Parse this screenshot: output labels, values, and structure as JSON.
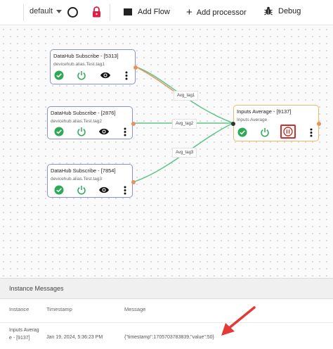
{
  "toolbar": {
    "flow_name": "default",
    "add_flow_label": "Add Flow",
    "add_processor_label": "Add processor",
    "debug_label": "Debug"
  },
  "nodes": {
    "sub1": {
      "title": "DataHub Subscribe - [5313]",
      "subtitle": "devicehub.alias.Test.tag1"
    },
    "sub2": {
      "title": "DataHub Subscribe - [2876]",
      "subtitle": "devicehub.alias.Test.tag2"
    },
    "sub3": {
      "title": "DataHub Subscribe - [7854]",
      "subtitle": "devicehub.alias.Test.tag3"
    },
    "avg": {
      "title": "Inputs Average - [9137]",
      "subtitle": "Inputs Average"
    }
  },
  "wire_labels": {
    "w1": "Avg_tag1",
    "w2": "Avg_tag2",
    "w3": "Avg_tag3"
  },
  "messages": {
    "title": "Instance Messages",
    "columns": {
      "instance": "Instance",
      "timestamp": "Timestamp",
      "message": "Message"
    },
    "rows": [
      {
        "instance_line1": "Inputs Averag",
        "instance_line2": "e - [9137]",
        "timestamp": "Jan 19, 2024, 5:36:23 PM",
        "message": "{\"timestamp\":1705703783839,\"value\":50}"
      }
    ]
  },
  "colors": {
    "ok_green": "#2eaa57",
    "power_green": "#2eaa57",
    "subscribe_border": "#8a8fd6",
    "average_border": "#f0b869",
    "wire_green": "#5fc58a",
    "highlight_red": "#d42c2c",
    "lock_red": "#e01e45"
  },
  "icons": [
    "menu-icon",
    "chevron-down-icon",
    "circle-icon",
    "lock-icon",
    "flow-icon",
    "plus-icon",
    "bug-icon",
    "check-circle-icon",
    "power-icon",
    "eye-icon",
    "more-vert-icon",
    "pause-icon",
    "arrow-annotation"
  ]
}
